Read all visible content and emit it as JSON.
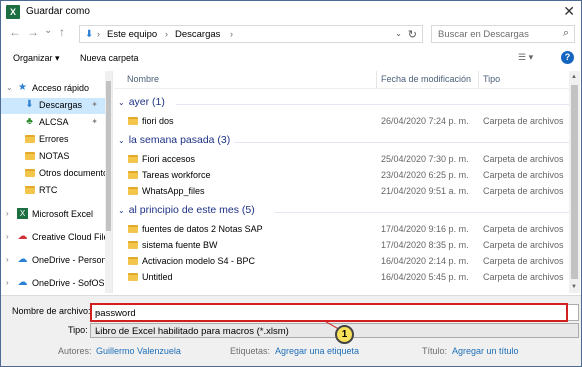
{
  "window": {
    "title": "Guardar como",
    "app_icon": "X",
    "close": "✕"
  },
  "nav": {
    "back": "←",
    "forward": "→",
    "recent": "⌄",
    "up": "↑",
    "breadcrumb": [
      "Este equipo",
      "Descargas"
    ],
    "search_placeholder": "Buscar en Descargas"
  },
  "toolbar": {
    "organize": "Organizar ▾",
    "new_folder": "Nueva carpeta",
    "view": "☰ ▾",
    "help": "?"
  },
  "sidebar": {
    "items": [
      {
        "label": "Acceso rápido",
        "icon": "star-icon"
      },
      {
        "label": "Descargas",
        "icon": "download-icon",
        "pinned": true,
        "selected": true
      },
      {
        "label": "ALCSA",
        "icon": "tree-icon",
        "pinned": true
      },
      {
        "label": "Errores",
        "icon": "folder-icon"
      },
      {
        "label": "NOTAS",
        "icon": "folder-icon"
      },
      {
        "label": "Otros documentos",
        "icon": "folder-icon"
      },
      {
        "label": "RTC",
        "icon": "folder-icon"
      },
      {
        "label": "Microsoft Excel",
        "icon": "excel-icon"
      },
      {
        "label": "Creative Cloud Files",
        "icon": "cloud-icon"
      },
      {
        "label": "OneDrive - Personal",
        "icon": "cloud-icon"
      },
      {
        "label": "OneDrive - SofOS",
        "icon": "cloud-icon"
      }
    ]
  },
  "columns": {
    "name": "Nombre",
    "date": "Fecha de modificación",
    "type": "Tipo"
  },
  "groups": [
    {
      "label": "ayer (1)",
      "files": [
        {
          "name": "fiori dos",
          "date": "26/04/2020 7:24 p. m.",
          "type": "Carpeta de archivos"
        }
      ]
    },
    {
      "label": "la semana pasada (3)",
      "files": [
        {
          "name": "Fiori accesos",
          "date": "25/04/2020 7:30 p. m.",
          "type": "Carpeta de archivos"
        },
        {
          "name": "Tareas workforce",
          "date": "23/04/2020 6:25 p. m.",
          "type": "Carpeta de archivos"
        },
        {
          "name": "WhatsApp_files",
          "date": "21/04/2020 9:51 a. m.",
          "type": "Carpeta de archivos"
        }
      ]
    },
    {
      "label": "al principio de este mes (5)",
      "files": [
        {
          "name": "fuentes de datos 2 Notas SAP",
          "date": "17/04/2020 9:16 p. m.",
          "type": "Carpeta de archivos"
        },
        {
          "name": "sistema fuente BW",
          "date": "17/04/2020 8:35 p. m.",
          "type": "Carpeta de archivos"
        },
        {
          "name": "Activacion modelo S4 - BPC",
          "date": "16/04/2020 2:14 p. m.",
          "type": "Carpeta de archivos"
        },
        {
          "name": "Untitled",
          "date": "16/04/2020 5:45 p. m.",
          "type": "Carpeta de archivos"
        }
      ]
    }
  ],
  "form": {
    "filename_label": "Nombre de archivo:",
    "filename_value": "password",
    "type_label": "Tipo:",
    "type_value": "Libro de Excel habilitado para macros (*.xlsm)",
    "authors_label": "Autores:",
    "authors_value": "Guillermo Valenzuela",
    "tags_label": "Etiquetas:",
    "tags_value": "Agregar una etiqueta",
    "title_label": "Título:",
    "title_value": "Agregar un título"
  },
  "callout": {
    "number": "1"
  },
  "colors": {
    "accent": "#1e3287",
    "highlight": "#d21f1f",
    "selection": "#cce8ff",
    "callout": "#f7e15a"
  }
}
